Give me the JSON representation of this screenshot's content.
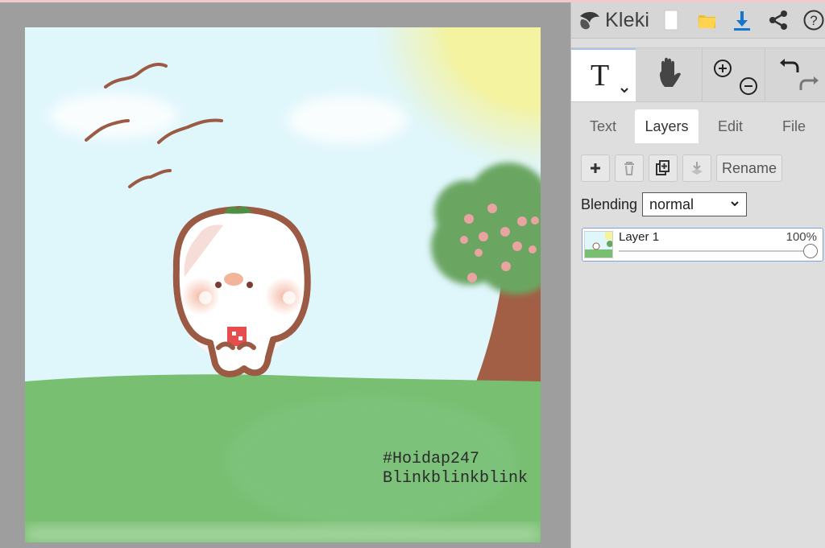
{
  "app": {
    "name": "Kleki",
    "top_icons": [
      "new-file-icon",
      "open-folder-icon",
      "download-icon",
      "share-icon",
      "help-icon"
    ]
  },
  "toolbar": {
    "tools": [
      {
        "name": "text-tool",
        "label": "T"
      },
      {
        "name": "hand-tool"
      },
      {
        "name": "zoom-tool"
      },
      {
        "name": "undo-redo"
      }
    ]
  },
  "tabs": [
    {
      "label": "Text",
      "active": false
    },
    {
      "label": "Layers",
      "active": true
    },
    {
      "label": "Edit",
      "active": false
    },
    {
      "label": "File",
      "active": false
    }
  ],
  "layers": {
    "buttons": {
      "rename": "Rename"
    },
    "blending": {
      "label": "Blending",
      "value": "normal"
    },
    "items": [
      {
        "name": "Layer 1",
        "opacity_text": "100%",
        "opacity": 1.0
      }
    ]
  },
  "canvas": {
    "text_lines": [
      "#Hoidap247",
      "Blinkblinkblink"
    ],
    "colors": {
      "sky": "#dff6fb",
      "grass": "#78bf72",
      "sun": "#f2f48f",
      "outline": "#9b5a43",
      "tree_trunk": "#a25f46",
      "blossom": "#e9a3a0"
    }
  },
  "colors": {
    "accent": "#1476d1",
    "panel": "#dedede",
    "selected_border": "#7ea3dc"
  }
}
